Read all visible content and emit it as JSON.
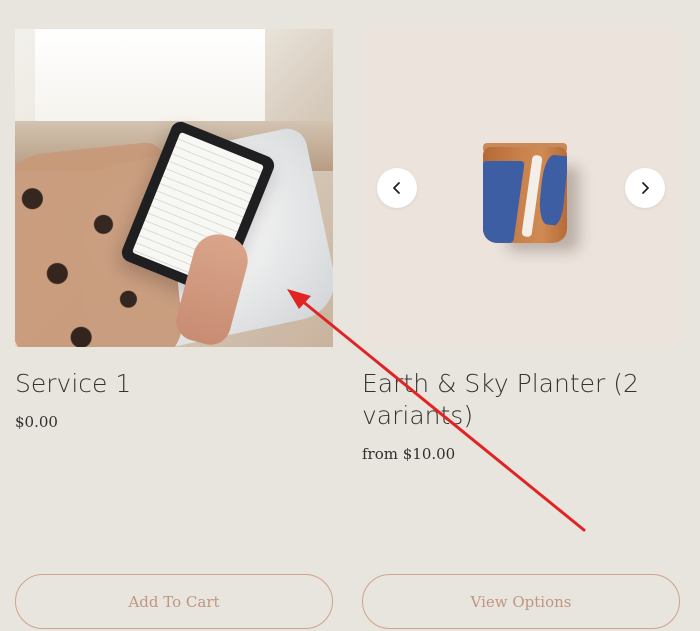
{
  "products": [
    {
      "title": "Service 1",
      "price": "$0.00",
      "button_label": "Add To Cart"
    },
    {
      "title": "Earth & Sky Planter (2 variants)",
      "price": "from $10.00",
      "button_label": "View Options"
    }
  ],
  "carousel": {
    "prev_symbol": "‹",
    "next_symbol": "›"
  },
  "colors": {
    "background": "#e8e4de",
    "button_border": "#cfa48c",
    "button_text": "#c09680",
    "annotation_arrow": "#e02424"
  },
  "icons": [
    "chevron-left-icon",
    "chevron-right-icon",
    "annotation-arrow"
  ]
}
